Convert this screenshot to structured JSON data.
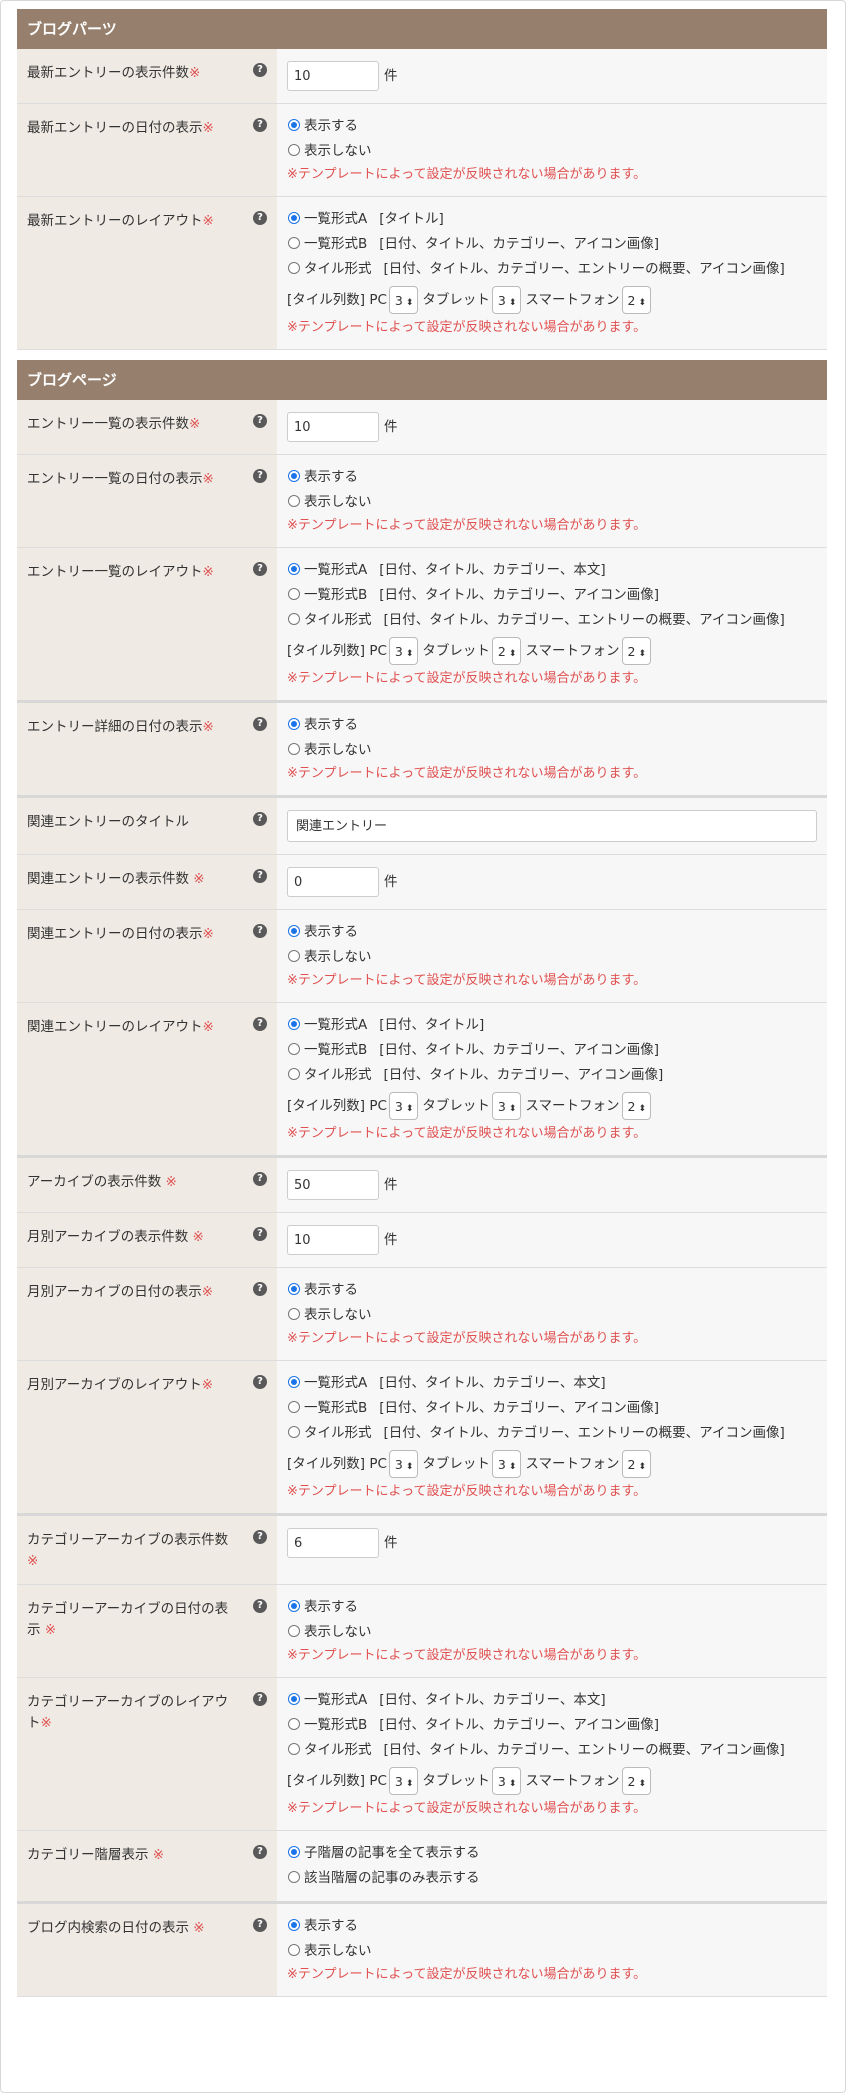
{
  "sections": [
    {
      "title": "ブログパーツ",
      "rows": [
        {
          "type": "number",
          "label": "最新エントリーの表示件数",
          "req": "※",
          "value": "10",
          "unit": "件"
        },
        {
          "type": "radio",
          "label": "最新エントリーの日付の表示",
          "req": "※",
          "options": [
            {
              "label": "表示する",
              "checked": true
            },
            {
              "label": "表示しない",
              "checked": false
            }
          ],
          "warn": "※テンプレートによって設定が反映されない場合があります。"
        },
        {
          "type": "layout",
          "label": "最新エントリーのレイアウト",
          "req": "※",
          "options": [
            {
              "label": "一覧形式A",
              "desc": "[タイトル]",
              "checked": true
            },
            {
              "label": "一覧形式B",
              "desc": "[日付、タイトル、カテゴリー、アイコン画像]",
              "checked": false
            },
            {
              "label": "タイル形式",
              "desc": "[日付、タイトル、カテゴリー、エントリーの概要、アイコン画像]",
              "checked": false
            }
          ],
          "cols": {
            "prefix": "[タイル列数] PC",
            "pc": "3",
            "tablet_label": "タブレット",
            "tablet": "3",
            "phone_label": "スマートフォン",
            "phone": "2"
          },
          "warn": "※テンプレートによって設定が反映されない場合があります。"
        }
      ]
    },
    {
      "title": "ブログページ",
      "rows": [
        {
          "type": "number",
          "label": "エントリー一覧の表示件数",
          "req": "※",
          "value": "10",
          "unit": "件"
        },
        {
          "type": "radio",
          "label": "エントリー一覧の日付の表示",
          "req": "※",
          "options": [
            {
              "label": "表示する",
              "checked": true
            },
            {
              "label": "表示しない",
              "checked": false
            }
          ],
          "warn": "※テンプレートによって設定が反映されない場合があります。"
        },
        {
          "type": "layout",
          "label": "エントリー一覧のレイアウト",
          "req": "※",
          "thick": true,
          "options": [
            {
              "label": "一覧形式A",
              "desc": "[日付、タイトル、カテゴリー、本文]",
              "checked": true
            },
            {
              "label": "一覧形式B",
              "desc": "[日付、タイトル、カテゴリー、アイコン画像]",
              "checked": false
            },
            {
              "label": "タイル形式",
              "desc": "[日付、タイトル、カテゴリー、エントリーの概要、アイコン画像]",
              "checked": false
            }
          ],
          "cols": {
            "prefix": "[タイル列数] PC",
            "pc": "3",
            "tablet_label": "タブレット",
            "tablet": "2",
            "phone_label": "スマートフォン",
            "phone": "2"
          },
          "warn": "※テンプレートによって設定が反映されない場合があります。"
        },
        {
          "type": "radio",
          "label": "エントリー詳細の日付の表示",
          "req": "※",
          "thick": true,
          "options": [
            {
              "label": "表示する",
              "checked": true
            },
            {
              "label": "表示しない",
              "checked": false
            }
          ],
          "warn": "※テンプレートによって設定が反映されない場合があります。"
        },
        {
          "type": "text",
          "label": "関連エントリーのタイトル",
          "req": "",
          "value": "関連エントリー"
        },
        {
          "type": "number",
          "label": "関連エントリーの表示件数",
          "req": " ※",
          "value": "0",
          "unit": "件"
        },
        {
          "type": "radio",
          "label": "関連エントリーの日付の表示",
          "req": "※",
          "options": [
            {
              "label": "表示する",
              "checked": true
            },
            {
              "label": "表示しない",
              "checked": false
            }
          ],
          "warn": "※テンプレートによって設定が反映されない場合があります。"
        },
        {
          "type": "layout",
          "label": "関連エントリーのレイアウト",
          "req": "※",
          "thick": true,
          "options": [
            {
              "label": "一覧形式A",
              "desc": "[日付、タイトル]",
              "checked": true
            },
            {
              "label": "一覧形式B",
              "desc": "[日付、タイトル、カテゴリー、アイコン画像]",
              "checked": false
            },
            {
              "label": "タイル形式",
              "desc": "[日付、タイトル、カテゴリー、アイコン画像]",
              "checked": false
            }
          ],
          "cols": {
            "prefix": "[タイル列数] PC",
            "pc": "3",
            "tablet_label": "タブレット",
            "tablet": "3",
            "phone_label": "スマートフォン",
            "phone": "2"
          },
          "warn": "※テンプレートによって設定が反映されない場合があります。"
        },
        {
          "type": "number",
          "label": "アーカイブの表示件数",
          "req": " ※",
          "value": "50",
          "unit": "件"
        },
        {
          "type": "number",
          "label": "月別アーカイブの表示件数",
          "req": " ※",
          "value": "10",
          "unit": "件"
        },
        {
          "type": "radio",
          "label": "月別アーカイブの日付の表示",
          "req": "※",
          "options": [
            {
              "label": "表示する",
              "checked": true
            },
            {
              "label": "表示しない",
              "checked": false
            }
          ],
          "warn": "※テンプレートによって設定が反映されない場合があります。"
        },
        {
          "type": "layout",
          "label": "月別アーカイブのレイアウト",
          "req": "※",
          "thick": true,
          "options": [
            {
              "label": "一覧形式A",
              "desc": "[日付、タイトル、カテゴリー、本文]",
              "checked": true
            },
            {
              "label": "一覧形式B",
              "desc": "[日付、タイトル、カテゴリー、アイコン画像]",
              "checked": false
            },
            {
              "label": "タイル形式",
              "desc": "[日付、タイトル、カテゴリー、エントリーの概要、アイコン画像]",
              "checked": false
            }
          ],
          "cols": {
            "prefix": "[タイル列数] PC",
            "pc": "3",
            "tablet_label": "タブレット",
            "tablet": "3",
            "phone_label": "スマートフォン",
            "phone": "2"
          },
          "warn": "※テンプレートによって設定が反映されない場合があります。"
        },
        {
          "type": "number",
          "label": "カテゴリーアーカイブの表示件数",
          "req": " ※",
          "value": "6",
          "unit": "件"
        },
        {
          "type": "radio",
          "label": "カテゴリーアーカイブの日付の表示",
          "req": " ※",
          "options": [
            {
              "label": "表示する",
              "checked": true
            },
            {
              "label": "表示しない",
              "checked": false
            }
          ],
          "warn": "※テンプレートによって設定が反映されない場合があります。"
        },
        {
          "type": "layout",
          "label": "カテゴリーアーカイブのレイアウト",
          "req": "※",
          "options": [
            {
              "label": "一覧形式A",
              "desc": "[日付、タイトル、カテゴリー、本文]",
              "checked": true
            },
            {
              "label": "一覧形式B",
              "desc": "[日付、タイトル、カテゴリー、アイコン画像]",
              "checked": false
            },
            {
              "label": "タイル形式",
              "desc": "[日付、タイトル、カテゴリー、エントリーの概要、アイコン画像]",
              "checked": false
            }
          ],
          "cols": {
            "prefix": "[タイル列数] PC",
            "pc": "3",
            "tablet_label": "タブレット",
            "tablet": "3",
            "phone_label": "スマートフォン",
            "phone": "2"
          },
          "warn": "※テンプレートによって設定が反映されない場合があります。"
        },
        {
          "type": "radio",
          "label": "カテゴリー階層表示",
          "req": " ※",
          "thick": true,
          "options": [
            {
              "label": "子階層の記事を全て表示する",
              "checked": true
            },
            {
              "label": "該当階層の記事のみ表示する",
              "checked": false
            }
          ]
        },
        {
          "type": "radio",
          "label": "ブログ内検索の日付の表示",
          "req": " ※",
          "options": [
            {
              "label": "表示する",
              "checked": true
            },
            {
              "label": "表示しない",
              "checked": false
            }
          ],
          "warn": "※テンプレートによって設定が反映されない場合があります。"
        }
      ]
    }
  ],
  "help_glyph": "?",
  "select_arrow": "⬍",
  "icons": {
    "help": "question-circle-icon",
    "select": "select-arrows-icon"
  },
  "colors": {
    "header_bg": "#967f6c",
    "label_bg": "#efeae4",
    "value_bg": "#f7f7f7",
    "required": "#e05050",
    "radio_checked": "#1a73e8"
  }
}
